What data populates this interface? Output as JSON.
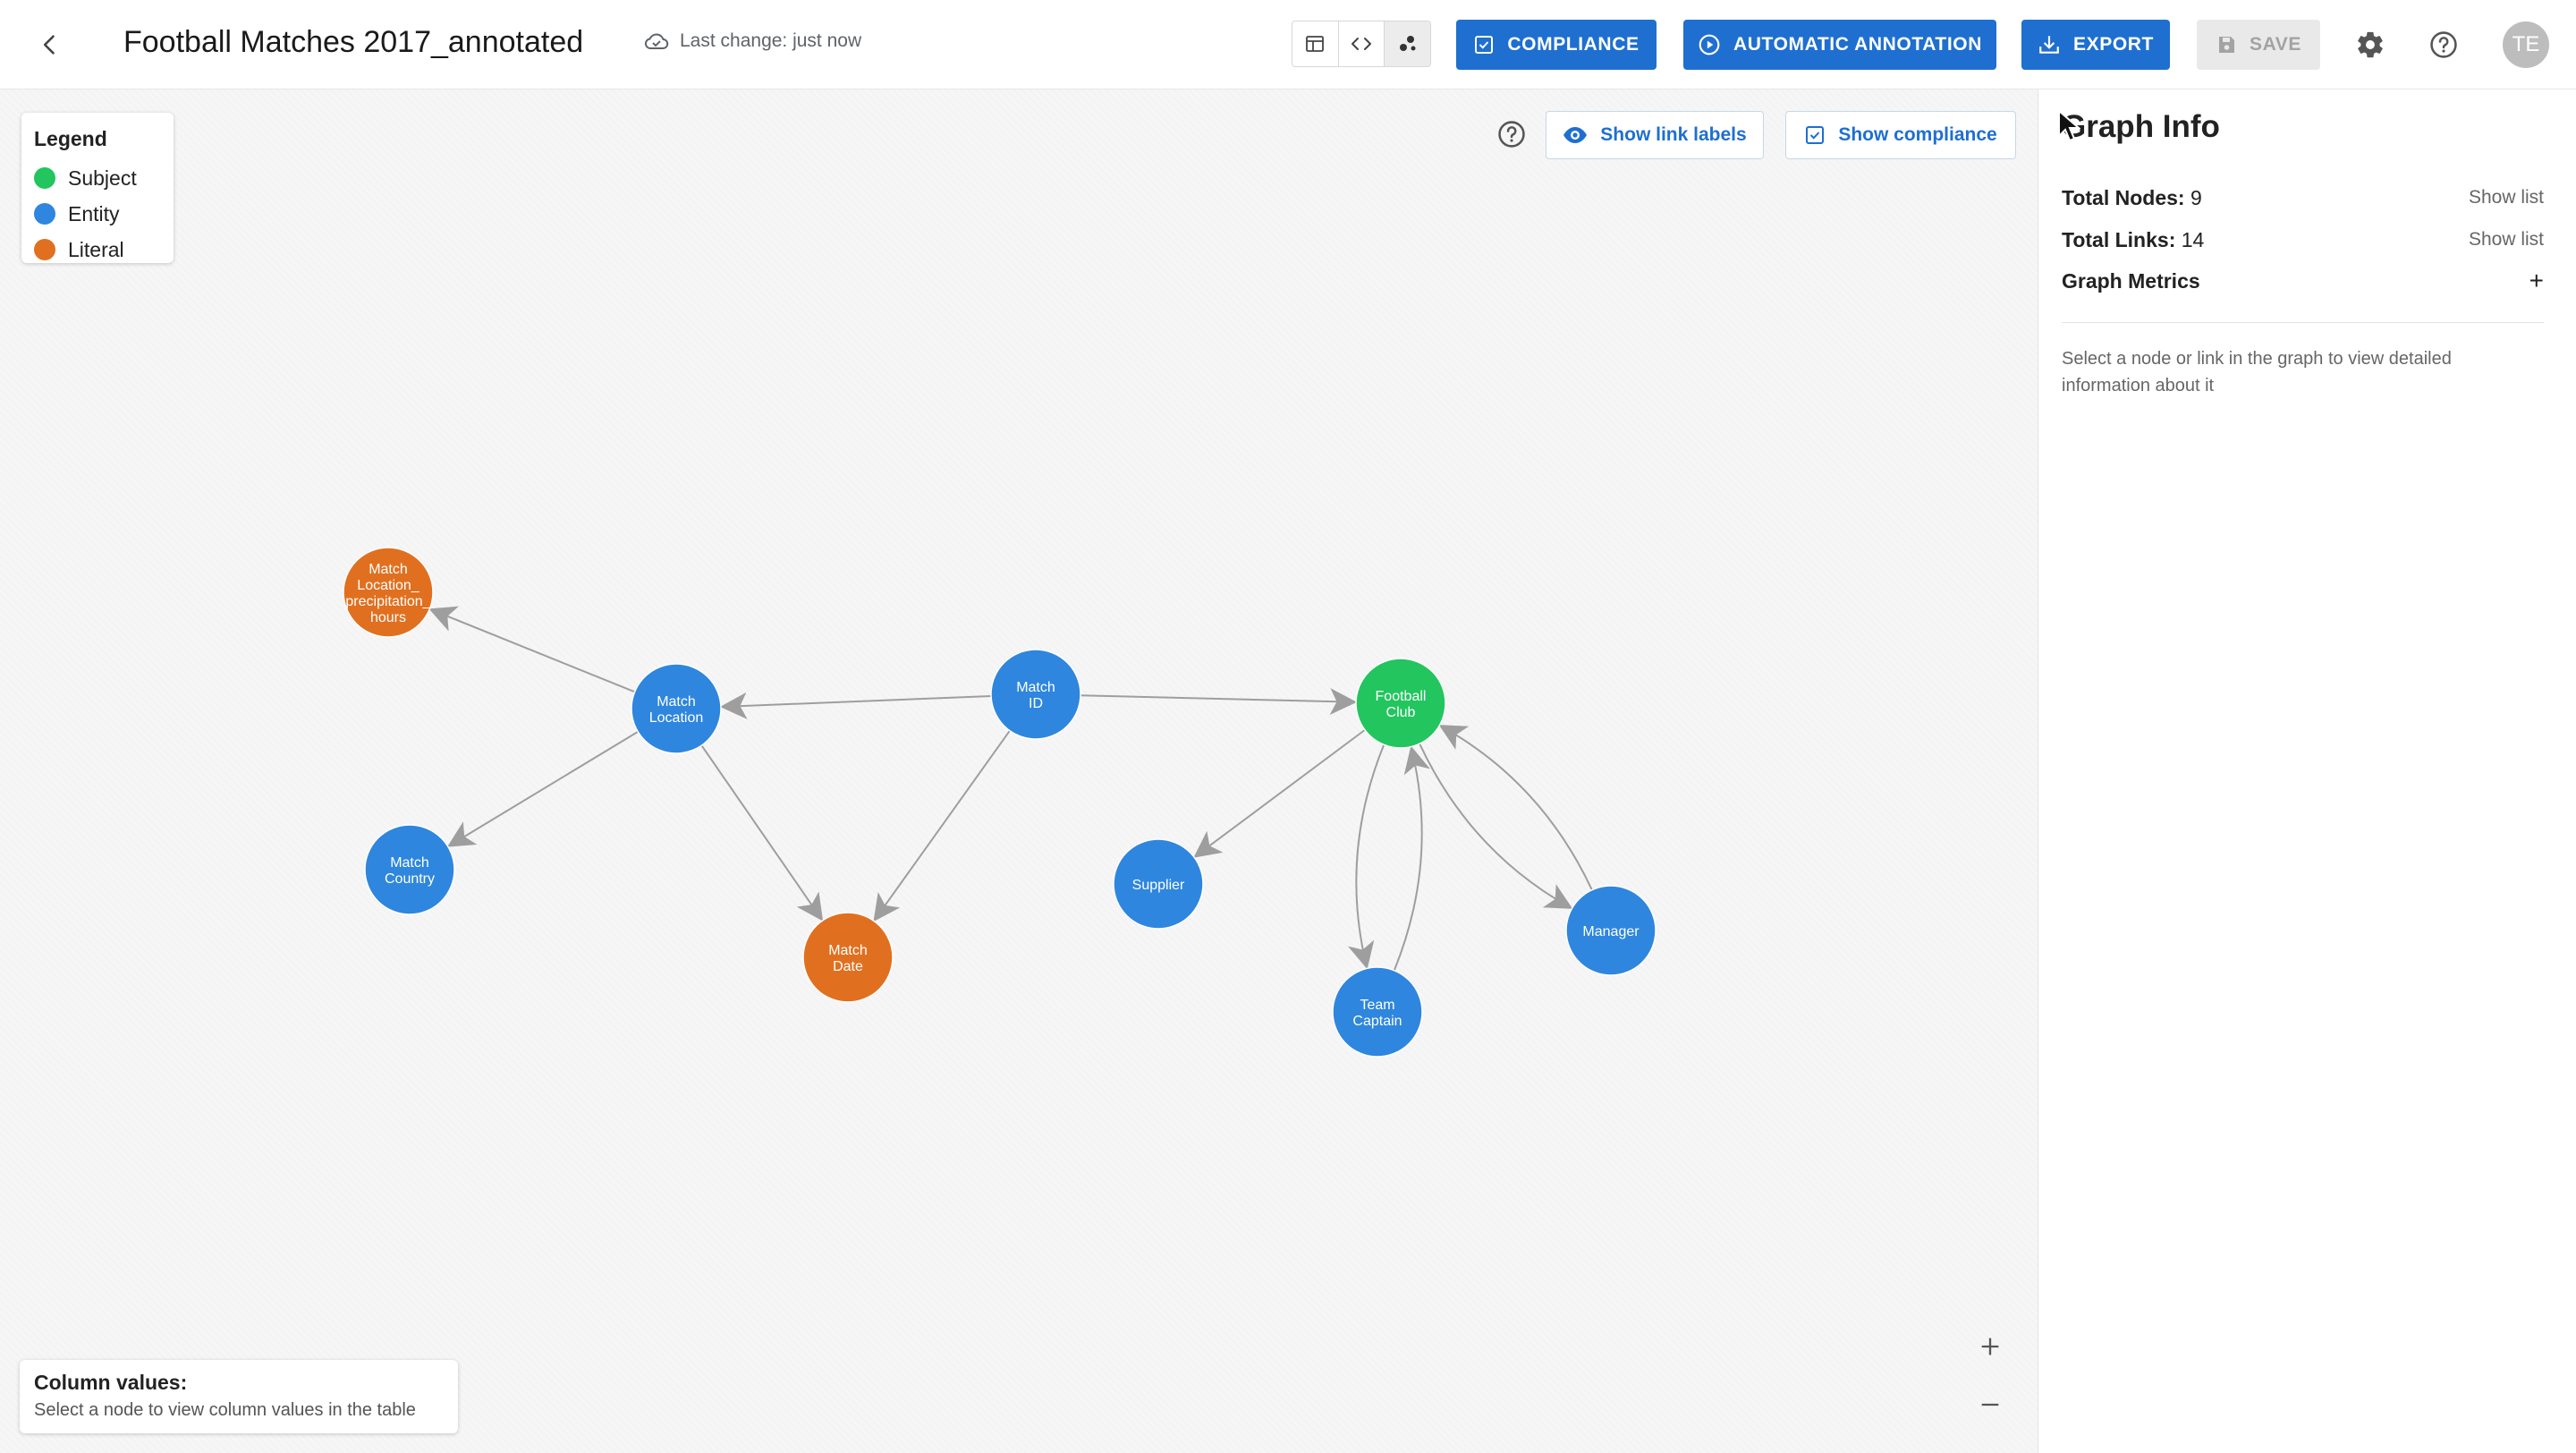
{
  "header": {
    "title": "Football Matches 2017_annotated",
    "last_change": "Last change: just now",
    "buttons": {
      "compliance": "COMPLIANCE",
      "automatic_annotation": "AUTOMATIC ANNOTATION",
      "export": "EXPORT",
      "save": "SAVE"
    },
    "avatar_initials": "TE"
  },
  "legend": {
    "title": "Legend",
    "items": [
      {
        "label": "Subject",
        "color": "#22c55e"
      },
      {
        "label": "Entity",
        "color": "#2e86de"
      },
      {
        "label": "Literal",
        "color": "#e07020"
      }
    ]
  },
  "canvas": {
    "show_link_labels": "Show link labels",
    "show_compliance": "Show compliance"
  },
  "column_values": {
    "title": "Column values:",
    "hint": "Select a node to view column values in the table"
  },
  "colors": {
    "subject": "#22c55e",
    "entity": "#2e86de",
    "literal": "#e07020",
    "edge": "#9e9e9e",
    "primary": "#1e6fd0"
  },
  "graph": {
    "nodes": [
      {
        "id": "precip",
        "lines": [
          "Match",
          "Location_",
          "precipitation_",
          "hours"
        ],
        "kind": "literal"
      },
      {
        "id": "location",
        "lines": [
          "Match",
          "Location"
        ],
        "kind": "entity"
      },
      {
        "id": "matchid",
        "lines": [
          "Match",
          "ID"
        ],
        "kind": "entity"
      },
      {
        "id": "club",
        "lines": [
          "Football",
          "Club"
        ],
        "kind": "subject"
      },
      {
        "id": "country",
        "lines": [
          "Match",
          "Country"
        ],
        "kind": "entity"
      },
      {
        "id": "date",
        "lines": [
          "Match",
          "Date"
        ],
        "kind": "literal"
      },
      {
        "id": "supplier",
        "lines": [
          "Supplier"
        ],
        "kind": "entity"
      },
      {
        "id": "captain",
        "lines": [
          "Team",
          "Captain"
        ],
        "kind": "entity"
      },
      {
        "id": "manager",
        "lines": [
          "Manager"
        ],
        "kind": "entity"
      }
    ]
  },
  "panel": {
    "title": "Graph Info",
    "total_nodes_label": "Total Nodes:",
    "total_nodes_value": "9",
    "total_links_label": "Total Links:",
    "total_links_value": "14",
    "show_list": "Show list",
    "graph_metrics": "Graph Metrics",
    "expand_symbol": "+",
    "hint": "Select a node or link in the graph to view detailed information about it"
  }
}
